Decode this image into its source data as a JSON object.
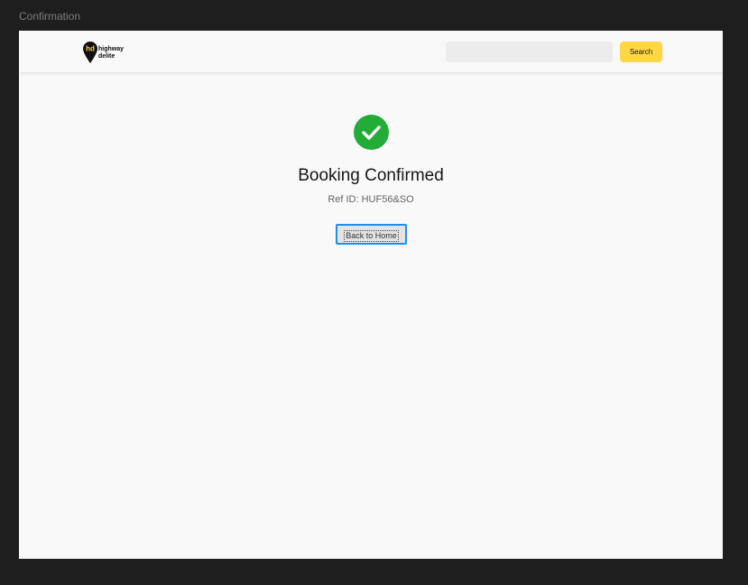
{
  "window": {
    "title": "Confirmation"
  },
  "navbar": {
    "logo": {
      "mark": "hd",
      "line1": "highway",
      "line2": "delite"
    },
    "search": {
      "value": "",
      "placeholder": "",
      "button_label": "Search"
    }
  },
  "confirmation": {
    "icon": "check-circle-icon",
    "heading": "Booking Confirmed",
    "ref_label": "Ref ID: HUF56&SO",
    "home_button_label": "Back to Home"
  },
  "colors": {
    "canvas": "#1e1e1e",
    "page_background": "#f9f9f9",
    "accent_yellow": "#ffd643",
    "success_green": "#24ac39",
    "focus_blue": "#1e8ef0"
  }
}
